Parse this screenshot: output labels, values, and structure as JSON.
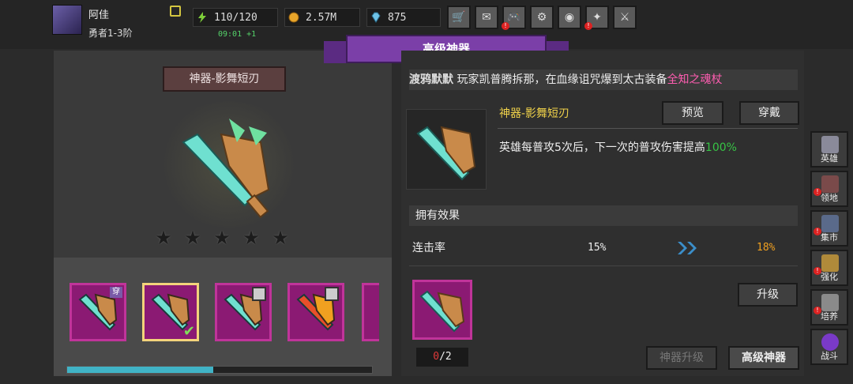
{
  "player": {
    "name": "阿佳",
    "rank": "勇者1-3阶"
  },
  "resources": {
    "energy": "110/120",
    "gold": "2.57M",
    "gems": "875",
    "energy_timer": "09:01 +1"
  },
  "toolbar": [
    {
      "name": "shop-cart-icon",
      "glyph": "🛒",
      "alert": false
    },
    {
      "name": "mail-icon",
      "glyph": "✉",
      "alert": false
    },
    {
      "name": "gamepad-icon",
      "glyph": "🎮",
      "alert": true
    },
    {
      "name": "gear-icon",
      "glyph": "⚙",
      "alert": false
    },
    {
      "name": "wheel-icon",
      "glyph": "◉",
      "alert": false
    },
    {
      "name": "magic-wand-icon",
      "glyph": "✦",
      "alert": true
    },
    {
      "name": "crossed-swords-icon",
      "glyph": "⚔",
      "alert": false
    }
  ],
  "panel_title": "高级神器",
  "selected_relic": {
    "name": "神器-影舞短刃",
    "stars": 5,
    "description_text": "英雄每普攻5次后，下一次的普攻伤害提高",
    "description_value": "100%"
  },
  "marquee": {
    "overlap_text": "渡鸦默默",
    "text": "玩家凯普腾拆那，在血缘诅咒爆到太古装备",
    "highlight": "全知之魂杖",
    "highlight_color": "#ff5db1"
  },
  "buttons": {
    "preview": "预览",
    "equip": "穿戴",
    "upgrade": "升级",
    "relic_upgrade": "神器升级",
    "advanced_relic": "高级神器"
  },
  "effects": {
    "header": "拥有效果",
    "rows": [
      {
        "label": "连击率",
        "current": "15%",
        "next": "18%"
      }
    ]
  },
  "upgrade_count": {
    "current": "0",
    "total": "/2"
  },
  "inventory": [
    {
      "name": "relic-slot-1",
      "tag": "穿",
      "locked": false,
      "selected": false
    },
    {
      "name": "relic-slot-2",
      "tag": "",
      "locked": false,
      "selected": true
    },
    {
      "name": "relic-slot-3",
      "tag": "",
      "locked": true,
      "selected": false
    },
    {
      "name": "relic-slot-4",
      "tag": "",
      "locked": true,
      "selected": false
    }
  ],
  "inventory_scroll": 0.48,
  "side_nav": [
    {
      "label": "英雄",
      "icon": "helmet-icon",
      "alert": false
    },
    {
      "label": "领地",
      "icon": "castle-icon",
      "alert": true
    },
    {
      "label": "集市",
      "icon": "market-icon",
      "alert": true
    },
    {
      "label": "强化",
      "icon": "emblem-icon",
      "alert": true
    },
    {
      "label": "培养",
      "icon": "trophy-icon",
      "alert": true
    },
    {
      "label": "战斗",
      "icon": "portal-icon",
      "alert": false
    }
  ],
  "colors": {
    "accent_purple": "#7b3fa8",
    "slot_magenta": "#8b1a73",
    "gold_text": "#f0d24a",
    "green_text": "#37c445",
    "orange_text": "#f0a020"
  }
}
